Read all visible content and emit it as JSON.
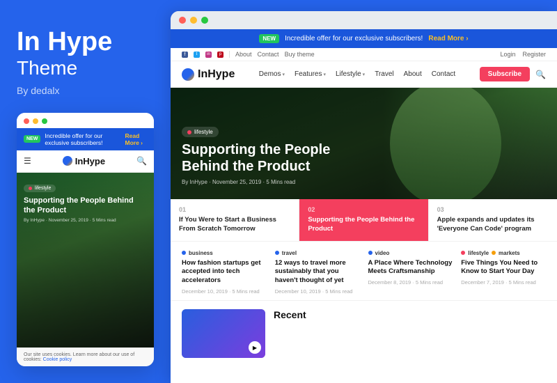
{
  "left": {
    "brand": {
      "title": "In Hype",
      "subtitle": "Theme",
      "author": "By dedalx"
    },
    "mobile": {
      "dots": [
        "red",
        "yellow",
        "green"
      ],
      "banner": {
        "badge": "NEW",
        "text": "Incredible offer for our exclusive subscribers!",
        "read_more": "Read More ›"
      },
      "navbar": {
        "logo": "InHype"
      },
      "hero": {
        "tag": "lifestyle",
        "title": "Supporting the People Behind the Product",
        "meta": "By InHype  ·  November 25, 2019  ·  5 Mins read"
      },
      "cookie": {
        "text": "Our site uses cookies. Learn more about our use of cookies:",
        "link": "Cookie policy"
      }
    }
  },
  "right": {
    "chrome": {
      "dots": [
        "red",
        "yellow",
        "green"
      ]
    },
    "banner": {
      "badge": "NEW",
      "text": "Incredible offer for our exclusive subscribers!",
      "read_more": "Read More ›"
    },
    "topnav": {
      "left_items": [
        "f",
        "t",
        "in",
        "p"
      ],
      "right_items": [
        "About",
        "Contact",
        "Buy theme"
      ],
      "auth": [
        "Login",
        "Register"
      ]
    },
    "mainnav": {
      "logo": "InHype",
      "items": [
        {
          "label": "Demos",
          "has_dropdown": true
        },
        {
          "label": "Features",
          "has_dropdown": true
        },
        {
          "label": "Lifestyle",
          "has_dropdown": true
        },
        {
          "label": "Travel",
          "has_dropdown": false
        },
        {
          "label": "About",
          "has_dropdown": false
        },
        {
          "label": "Contact",
          "has_dropdown": false
        }
      ],
      "subscribe": "Subscribe"
    },
    "hero": {
      "tag": "lifestyle",
      "title": "Supporting the People Behind the Product",
      "meta": "By InHype  ·  November 25, 2019  ·  5 Mins read"
    },
    "cards": [
      {
        "num": "01",
        "title": "If You Were to Start a Business From Scratch Tomorrow",
        "highlighted": false
      },
      {
        "num": "02",
        "title": "Supporting the People Behind the Product",
        "highlighted": true
      },
      {
        "num": "03",
        "title": "Apple expands and updates its 'Everyone Can Code' program",
        "highlighted": false
      }
    ],
    "articles": [
      {
        "tag": "business",
        "tag_color": "#2563eb",
        "title": "How fashion startups get accepted into tech accelerators",
        "meta": "December 10, 2019  ·  5 Mins read"
      },
      {
        "tag": "travel",
        "tag_color": "#2563eb",
        "title": "12 ways to travel more sustainably that you haven't thought of yet",
        "meta": "December 10, 2019  ·  5 Mins read"
      },
      {
        "tag": "video",
        "tag_color": "#2563eb",
        "title": "A Place Where Technology Meets Craftsmanship",
        "meta": "December 8, 2019  ·  5 Mins read"
      },
      {
        "tag": "lifestyle",
        "tag_color": "#f43f5e",
        "title": "Five Things You Need to Know to Start Your Day",
        "meta": "December 7, 2019  ·  5 Mins read",
        "tag2": "markets",
        "tag2_color": "#f59e0b"
      }
    ],
    "bottom": {
      "recent_title": "Recent"
    }
  }
}
